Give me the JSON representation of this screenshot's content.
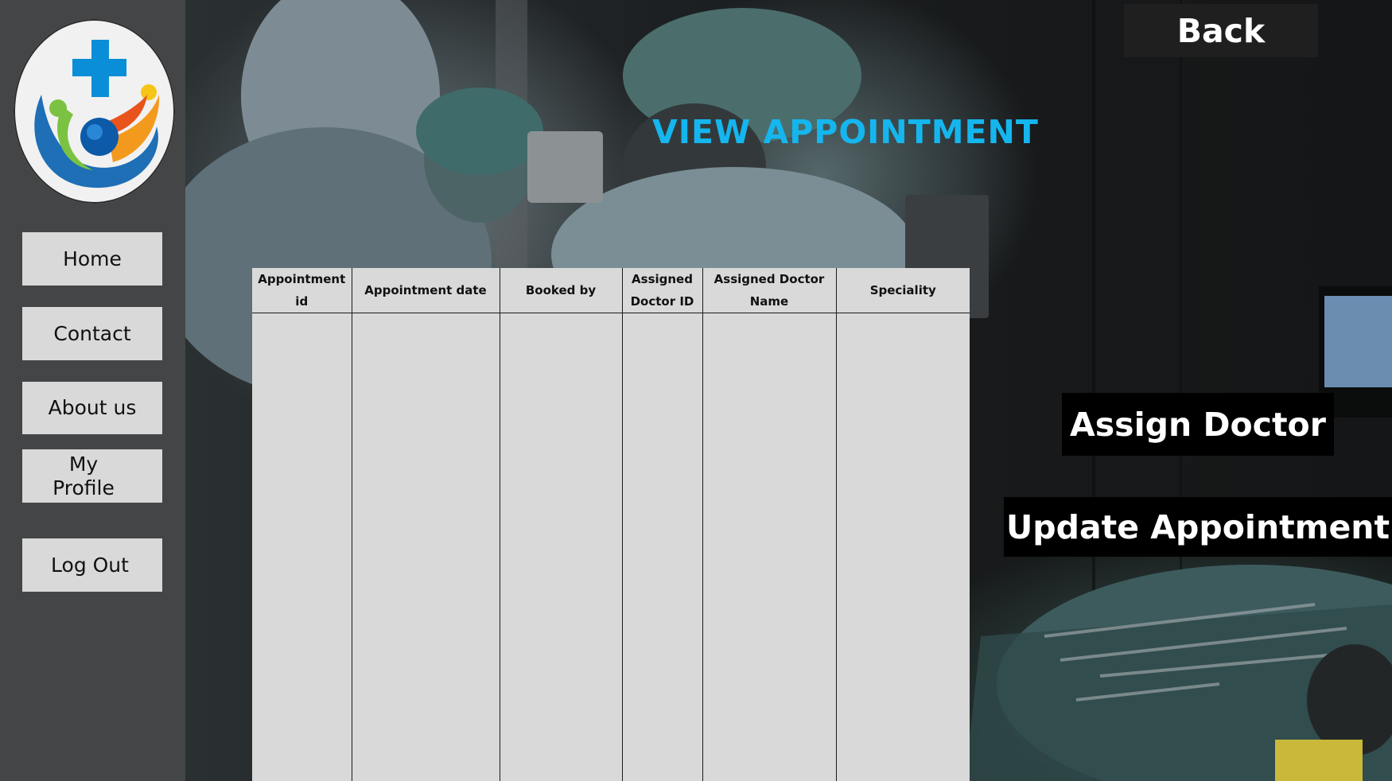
{
  "nav": {
    "items": [
      {
        "label": "Home"
      },
      {
        "label": "Contact"
      },
      {
        "label": "About us"
      },
      {
        "label": "My",
        "label2": "Profile"
      },
      {
        "label": "Log Out"
      }
    ]
  },
  "header": {
    "title": "VIEW APPOINTMENT",
    "back_label": "Back"
  },
  "actions": {
    "assign_label": "Assign Doctor",
    "update_label": "Update Appointment"
  },
  "table": {
    "columns": [
      "Appointment id",
      "Appointment date",
      "Booked by",
      "Assigned Doctor ID",
      "Assigned Doctor Name",
      "Speciality"
    ],
    "rows": []
  },
  "colors": {
    "sidebar": "#444546",
    "nav_button": "#d9d9d9",
    "title": "#15b6ee",
    "table": "#d9d9d9",
    "action_button": "#000000"
  }
}
